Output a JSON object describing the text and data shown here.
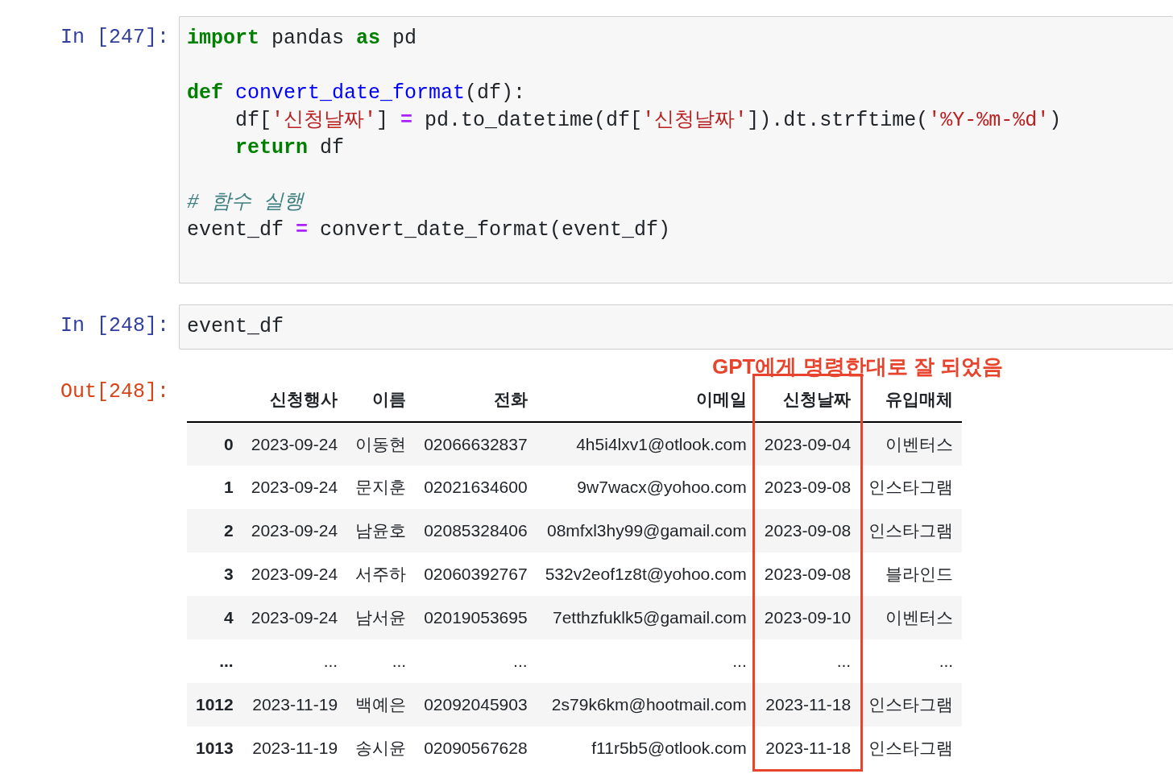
{
  "cells": [
    {
      "prompt": "In [247]:",
      "code": [
        {
          "text": "import",
          "kind": "keyword"
        },
        {
          "text": " pandas ",
          "kind": "plain"
        },
        {
          "text": "as",
          "kind": "keyword"
        },
        {
          "text": " pd\n\n",
          "kind": "plain"
        },
        {
          "text": "def",
          "kind": "keyword"
        },
        {
          "text": " convert_date_format",
          "kind": "function"
        },
        {
          "text": "(df):\n    df[",
          "kind": "plain"
        },
        {
          "text": "'신청날짜'",
          "kind": "string"
        },
        {
          "text": "] ",
          "kind": "plain"
        },
        {
          "text": "=",
          "kind": "operator"
        },
        {
          "text": " pd.to_datetime(df[",
          "kind": "plain"
        },
        {
          "text": "'신청날짜'",
          "kind": "string"
        },
        {
          "text": "]).dt.strftime(",
          "kind": "plain"
        },
        {
          "text": "'%Y-%m-%d'",
          "kind": "string"
        },
        {
          "text": ")\n    ",
          "kind": "plain"
        },
        {
          "text": "return",
          "kind": "keyword"
        },
        {
          "text": " df\n\n",
          "kind": "plain"
        },
        {
          "text": "# 함수 실행",
          "kind": "comment"
        },
        {
          "text": "\nevent_df ",
          "kind": "plain"
        },
        {
          "text": "=",
          "kind": "operator"
        },
        {
          "text": " convert_date_format(event_df)",
          "kind": "plain"
        }
      ]
    },
    {
      "prompt": "In [248]:",
      "code": [
        {
          "text": "event_df",
          "kind": "plain"
        }
      ]
    }
  ],
  "output": {
    "prompt": "Out[248]:",
    "annotation": "GPT에게 명령한대로 잘 되었음",
    "table": {
      "columns": [
        {
          "label": "신청행사",
          "highlighted": false
        },
        {
          "label": "이름",
          "highlighted": false
        },
        {
          "label": "전화",
          "highlighted": false
        },
        {
          "label": "이메일",
          "highlighted": false
        },
        {
          "label": "신청날짜",
          "highlighted": true
        },
        {
          "label": "유입매체",
          "highlighted": false
        }
      ],
      "rows": [
        {
          "index": "0",
          "cells": [
            "2023-09-24",
            "이동현",
            "02066632837",
            "4h5i4lxv1@otlook.com",
            "2023-09-04",
            "이벤터스"
          ]
        },
        {
          "index": "1",
          "cells": [
            "2023-09-24",
            "문지훈",
            "02021634600",
            "9w7wacx@yohoo.com",
            "2023-09-08",
            "인스타그램"
          ]
        },
        {
          "index": "2",
          "cells": [
            "2023-09-24",
            "남윤호",
            "02085328406",
            "08mfxl3hy99@gamail.com",
            "2023-09-08",
            "인스타그램"
          ]
        },
        {
          "index": "3",
          "cells": [
            "2023-09-24",
            "서주하",
            "02060392767",
            "532v2eof1z8t@yohoo.com",
            "2023-09-08",
            "블라인드"
          ]
        },
        {
          "index": "4",
          "cells": [
            "2023-09-24",
            "남서윤",
            "02019053695",
            "7etthzfuklk5@gamail.com",
            "2023-09-10",
            "이벤터스"
          ]
        },
        {
          "index": "...",
          "cells": [
            "...",
            "...",
            "...",
            "...",
            "...",
            "..."
          ]
        },
        {
          "index": "1012",
          "cells": [
            "2023-11-19",
            "백예은",
            "02092045903",
            "2s79k6km@hootmail.com",
            "2023-11-18",
            "인스타그램"
          ]
        },
        {
          "index": "1013",
          "cells": [
            "2023-11-19",
            "송시윤",
            "02090567628",
            "f11r5b5@otlook.com",
            "2023-11-18",
            "인스타그램"
          ]
        }
      ]
    }
  }
}
